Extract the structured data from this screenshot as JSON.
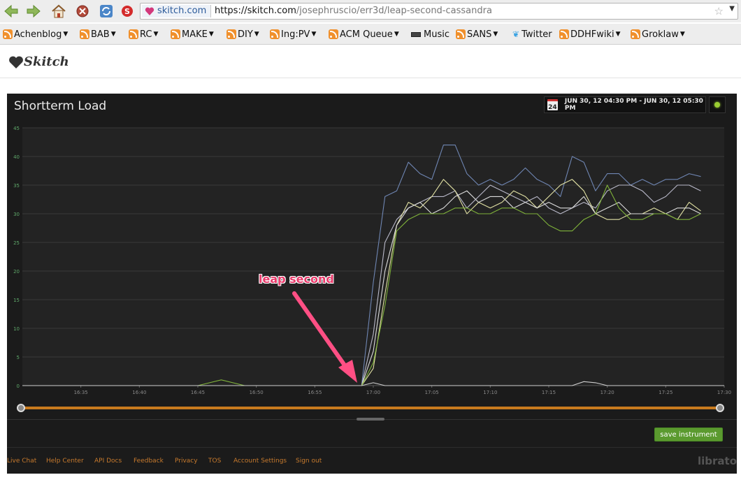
{
  "browser": {
    "site_identity": "skitch.com",
    "url_host": "https://skitch.com",
    "url_path": "/josephruscio/err3d/leap-second-cassandra",
    "bookmarks": [
      {
        "label": "Achenblog",
        "icon": "rss-icon",
        "dropdown": true
      },
      {
        "label": "BAB",
        "icon": "rss-icon",
        "dropdown": true
      },
      {
        "label": "RC",
        "icon": "rss-icon",
        "dropdown": true
      },
      {
        "label": "MAKE",
        "icon": "rss-icon",
        "dropdown": true
      },
      {
        "label": "DIY",
        "icon": "rss-icon",
        "dropdown": true
      },
      {
        "label": "Ing:PV",
        "icon": "rss-icon",
        "dropdown": true
      },
      {
        "label": "ACM Queue",
        "icon": "rss-icon",
        "dropdown": true
      },
      {
        "label": "Music",
        "icon": "keyboard-icon",
        "dropdown": false
      },
      {
        "label": "SANS",
        "icon": "rss-icon",
        "dropdown": true
      },
      {
        "label": "Twitter",
        "icon": "twitter-bird-icon",
        "dropdown": false
      },
      {
        "label": "DDHFwiki",
        "icon": "rss-icon",
        "dropdown": true
      },
      {
        "label": "Groklaw",
        "icon": "rss-icon",
        "dropdown": true
      }
    ]
  },
  "skitch": {
    "logo": "Skitch"
  },
  "dashboard": {
    "title": "Shortterm Load",
    "date_range": "JUN 30, 12 04:30 PM - JUN 30, 12 05:30 PM",
    "calendar_day": "24",
    "save_label": "save instrument",
    "brand": "librato",
    "footer_links": [
      "Live Chat",
      "Help Center",
      "API Docs",
      "Feedback",
      "Privacy",
      "TOS",
      "Account Settings",
      "Sign out"
    ]
  },
  "annotation": {
    "text": "leap second"
  },
  "chart_data": {
    "type": "line",
    "title": "Shortterm Load",
    "x_ticks": [
      "16:35",
      "16:40",
      "16:45",
      "16:50",
      "16:55",
      "17:00",
      "17:05",
      "17:10",
      "17:15",
      "17:20",
      "17:25",
      "17:30"
    ],
    "x_range": [
      "16:30",
      "17:30"
    ],
    "y_ticks": [
      0,
      5,
      10,
      15,
      20,
      25,
      30,
      35,
      40,
      45
    ],
    "ylim": [
      0,
      45
    ],
    "grid": true,
    "series": [
      {
        "color": "#6f86b3",
        "points": [
          [
            "16:30",
            0
          ],
          [
            "16:45",
            0
          ],
          [
            "16:59",
            0
          ],
          [
            "17:00",
            18
          ],
          [
            "17:01",
            33
          ],
          [
            "17:02",
            34
          ],
          [
            "17:03",
            39
          ],
          [
            "17:04",
            37
          ],
          [
            "17:05",
            36
          ],
          [
            "17:06",
            42
          ],
          [
            "17:07",
            42
          ],
          [
            "17:08",
            37
          ],
          [
            "17:09",
            35
          ],
          [
            "17:10",
            36
          ],
          [
            "17:11",
            35
          ],
          [
            "17:12",
            36
          ],
          [
            "17:13",
            38
          ],
          [
            "17:14",
            36
          ],
          [
            "17:15",
            35
          ],
          [
            "17:16",
            33
          ],
          [
            "17:17",
            40
          ],
          [
            "17:18",
            39
          ],
          [
            "17:19",
            34
          ],
          [
            "17:20",
            37
          ],
          [
            "17:21",
            37
          ],
          [
            "17:22",
            35
          ],
          [
            "17:23",
            36
          ],
          [
            "17:24",
            35
          ],
          [
            "17:25",
            36
          ],
          [
            "17:26",
            36
          ],
          [
            "17:27",
            37
          ],
          [
            "17:28",
            36.5
          ]
        ]
      },
      {
        "color": "#b9b9c9",
        "points": [
          [
            "16:30",
            0
          ],
          [
            "16:45",
            0
          ],
          [
            "16:59",
            0
          ],
          [
            "17:00",
            9
          ],
          [
            "17:01",
            25
          ],
          [
            "17:02",
            29
          ],
          [
            "17:03",
            31
          ],
          [
            "17:04",
            32
          ],
          [
            "17:05",
            33
          ],
          [
            "17:06",
            33
          ],
          [
            "17:07",
            34
          ],
          [
            "17:08",
            31
          ],
          [
            "17:09",
            33
          ],
          [
            "17:10",
            35
          ],
          [
            "17:11",
            34
          ],
          [
            "17:12",
            33
          ],
          [
            "17:13",
            32
          ],
          [
            "17:14",
            33
          ],
          [
            "17:15",
            31
          ],
          [
            "17:16",
            30
          ],
          [
            "17:17",
            31
          ],
          [
            "17:18",
            32
          ],
          [
            "17:19",
            31
          ],
          [
            "17:20",
            34
          ],
          [
            "17:21",
            35
          ],
          [
            "17:22",
            35
          ],
          [
            "17:23",
            34
          ],
          [
            "17:24",
            32
          ],
          [
            "17:25",
            33
          ],
          [
            "17:26",
            35
          ],
          [
            "17:27",
            35
          ],
          [
            "17:28",
            34
          ]
        ]
      },
      {
        "color": "#e2e2a4",
        "points": [
          [
            "16:30",
            0
          ],
          [
            "16:45",
            0
          ],
          [
            "16:59",
            0
          ],
          [
            "17:00",
            3
          ],
          [
            "17:01",
            16
          ],
          [
            "17:02",
            28
          ],
          [
            "17:03",
            32
          ],
          [
            "17:04",
            31
          ],
          [
            "17:05",
            33
          ],
          [
            "17:06",
            36
          ],
          [
            "17:07",
            34
          ],
          [
            "17:08",
            30
          ],
          [
            "17:09",
            32
          ],
          [
            "17:10",
            31
          ],
          [
            "17:11",
            32
          ],
          [
            "17:12",
            34
          ],
          [
            "17:13",
            33
          ],
          [
            "17:14",
            31
          ],
          [
            "17:15",
            33
          ],
          [
            "17:16",
            35
          ],
          [
            "17:17",
            36
          ],
          [
            "17:18",
            34
          ],
          [
            "17:19",
            30
          ],
          [
            "17:20",
            29
          ],
          [
            "17:21",
            29
          ],
          [
            "17:22",
            30
          ],
          [
            "17:23",
            30
          ],
          [
            "17:24",
            31
          ],
          [
            "17:25",
            30
          ],
          [
            "17:26",
            29
          ],
          [
            "17:27",
            32
          ],
          [
            "17:28",
            30.5
          ]
        ]
      },
      {
        "color": "#dcdcdc",
        "points": [
          [
            "16:30",
            0
          ],
          [
            "16:45",
            0
          ],
          [
            "16:59",
            0
          ],
          [
            "17:00",
            6
          ],
          [
            "17:01",
            20
          ],
          [
            "17:02",
            28
          ],
          [
            "17:03",
            31
          ],
          [
            "17:04",
            32
          ],
          [
            "17:05",
            30
          ],
          [
            "17:06",
            31
          ],
          [
            "17:07",
            33
          ],
          [
            "17:08",
            34
          ],
          [
            "17:09",
            32
          ],
          [
            "17:10",
            33
          ],
          [
            "17:11",
            33
          ],
          [
            "17:12",
            31
          ],
          [
            "17:13",
            32
          ],
          [
            "17:14",
            31
          ],
          [
            "17:15",
            32
          ],
          [
            "17:16",
            31
          ],
          [
            "17:17",
            31
          ],
          [
            "17:18",
            33
          ],
          [
            "17:19",
            30
          ],
          [
            "17:20",
            31
          ],
          [
            "17:21",
            32
          ],
          [
            "17:22",
            30
          ],
          [
            "17:23",
            30
          ],
          [
            "17:24",
            30
          ],
          [
            "17:25",
            30
          ],
          [
            "17:26",
            31
          ],
          [
            "17:27",
            31
          ],
          [
            "17:28",
            30
          ]
        ]
      },
      {
        "color": "#7fb23a",
        "points": [
          [
            "16:30",
            0
          ],
          [
            "16:45",
            0
          ],
          [
            "16:47",
            1
          ],
          [
            "16:49",
            0
          ],
          [
            "16:59",
            0
          ],
          [
            "17:00",
            4
          ],
          [
            "17:01",
            14
          ],
          [
            "17:02",
            27
          ],
          [
            "17:03",
            29
          ],
          [
            "17:04",
            30
          ],
          [
            "17:05",
            30
          ],
          [
            "17:06",
            30
          ],
          [
            "17:07",
            31
          ],
          [
            "17:08",
            31
          ],
          [
            "17:09",
            30
          ],
          [
            "17:10",
            30
          ],
          [
            "17:11",
            31
          ],
          [
            "17:12",
            31
          ],
          [
            "17:13",
            30
          ],
          [
            "17:14",
            30
          ],
          [
            "17:15",
            28
          ],
          [
            "17:16",
            27
          ],
          [
            "17:17",
            27
          ],
          [
            "17:18",
            29
          ],
          [
            "17:19",
            30
          ],
          [
            "17:20",
            35
          ],
          [
            "17:21",
            31
          ],
          [
            "17:22",
            29
          ],
          [
            "17:23",
            29
          ],
          [
            "17:24",
            30
          ],
          [
            "17:25",
            30
          ],
          [
            "17:26",
            29
          ],
          [
            "17:27",
            29
          ],
          [
            "17:28",
            30
          ]
        ]
      },
      {
        "color": "#cfcfcf",
        "points": [
          [
            "16:30",
            0
          ],
          [
            "16:59",
            0
          ],
          [
            "17:00",
            0.5
          ],
          [
            "17:01",
            0
          ],
          [
            "17:17",
            0
          ],
          [
            "17:18",
            0.7
          ],
          [
            "17:19",
            0.5
          ],
          [
            "17:20",
            0
          ],
          [
            "17:30",
            0
          ]
        ]
      }
    ]
  }
}
